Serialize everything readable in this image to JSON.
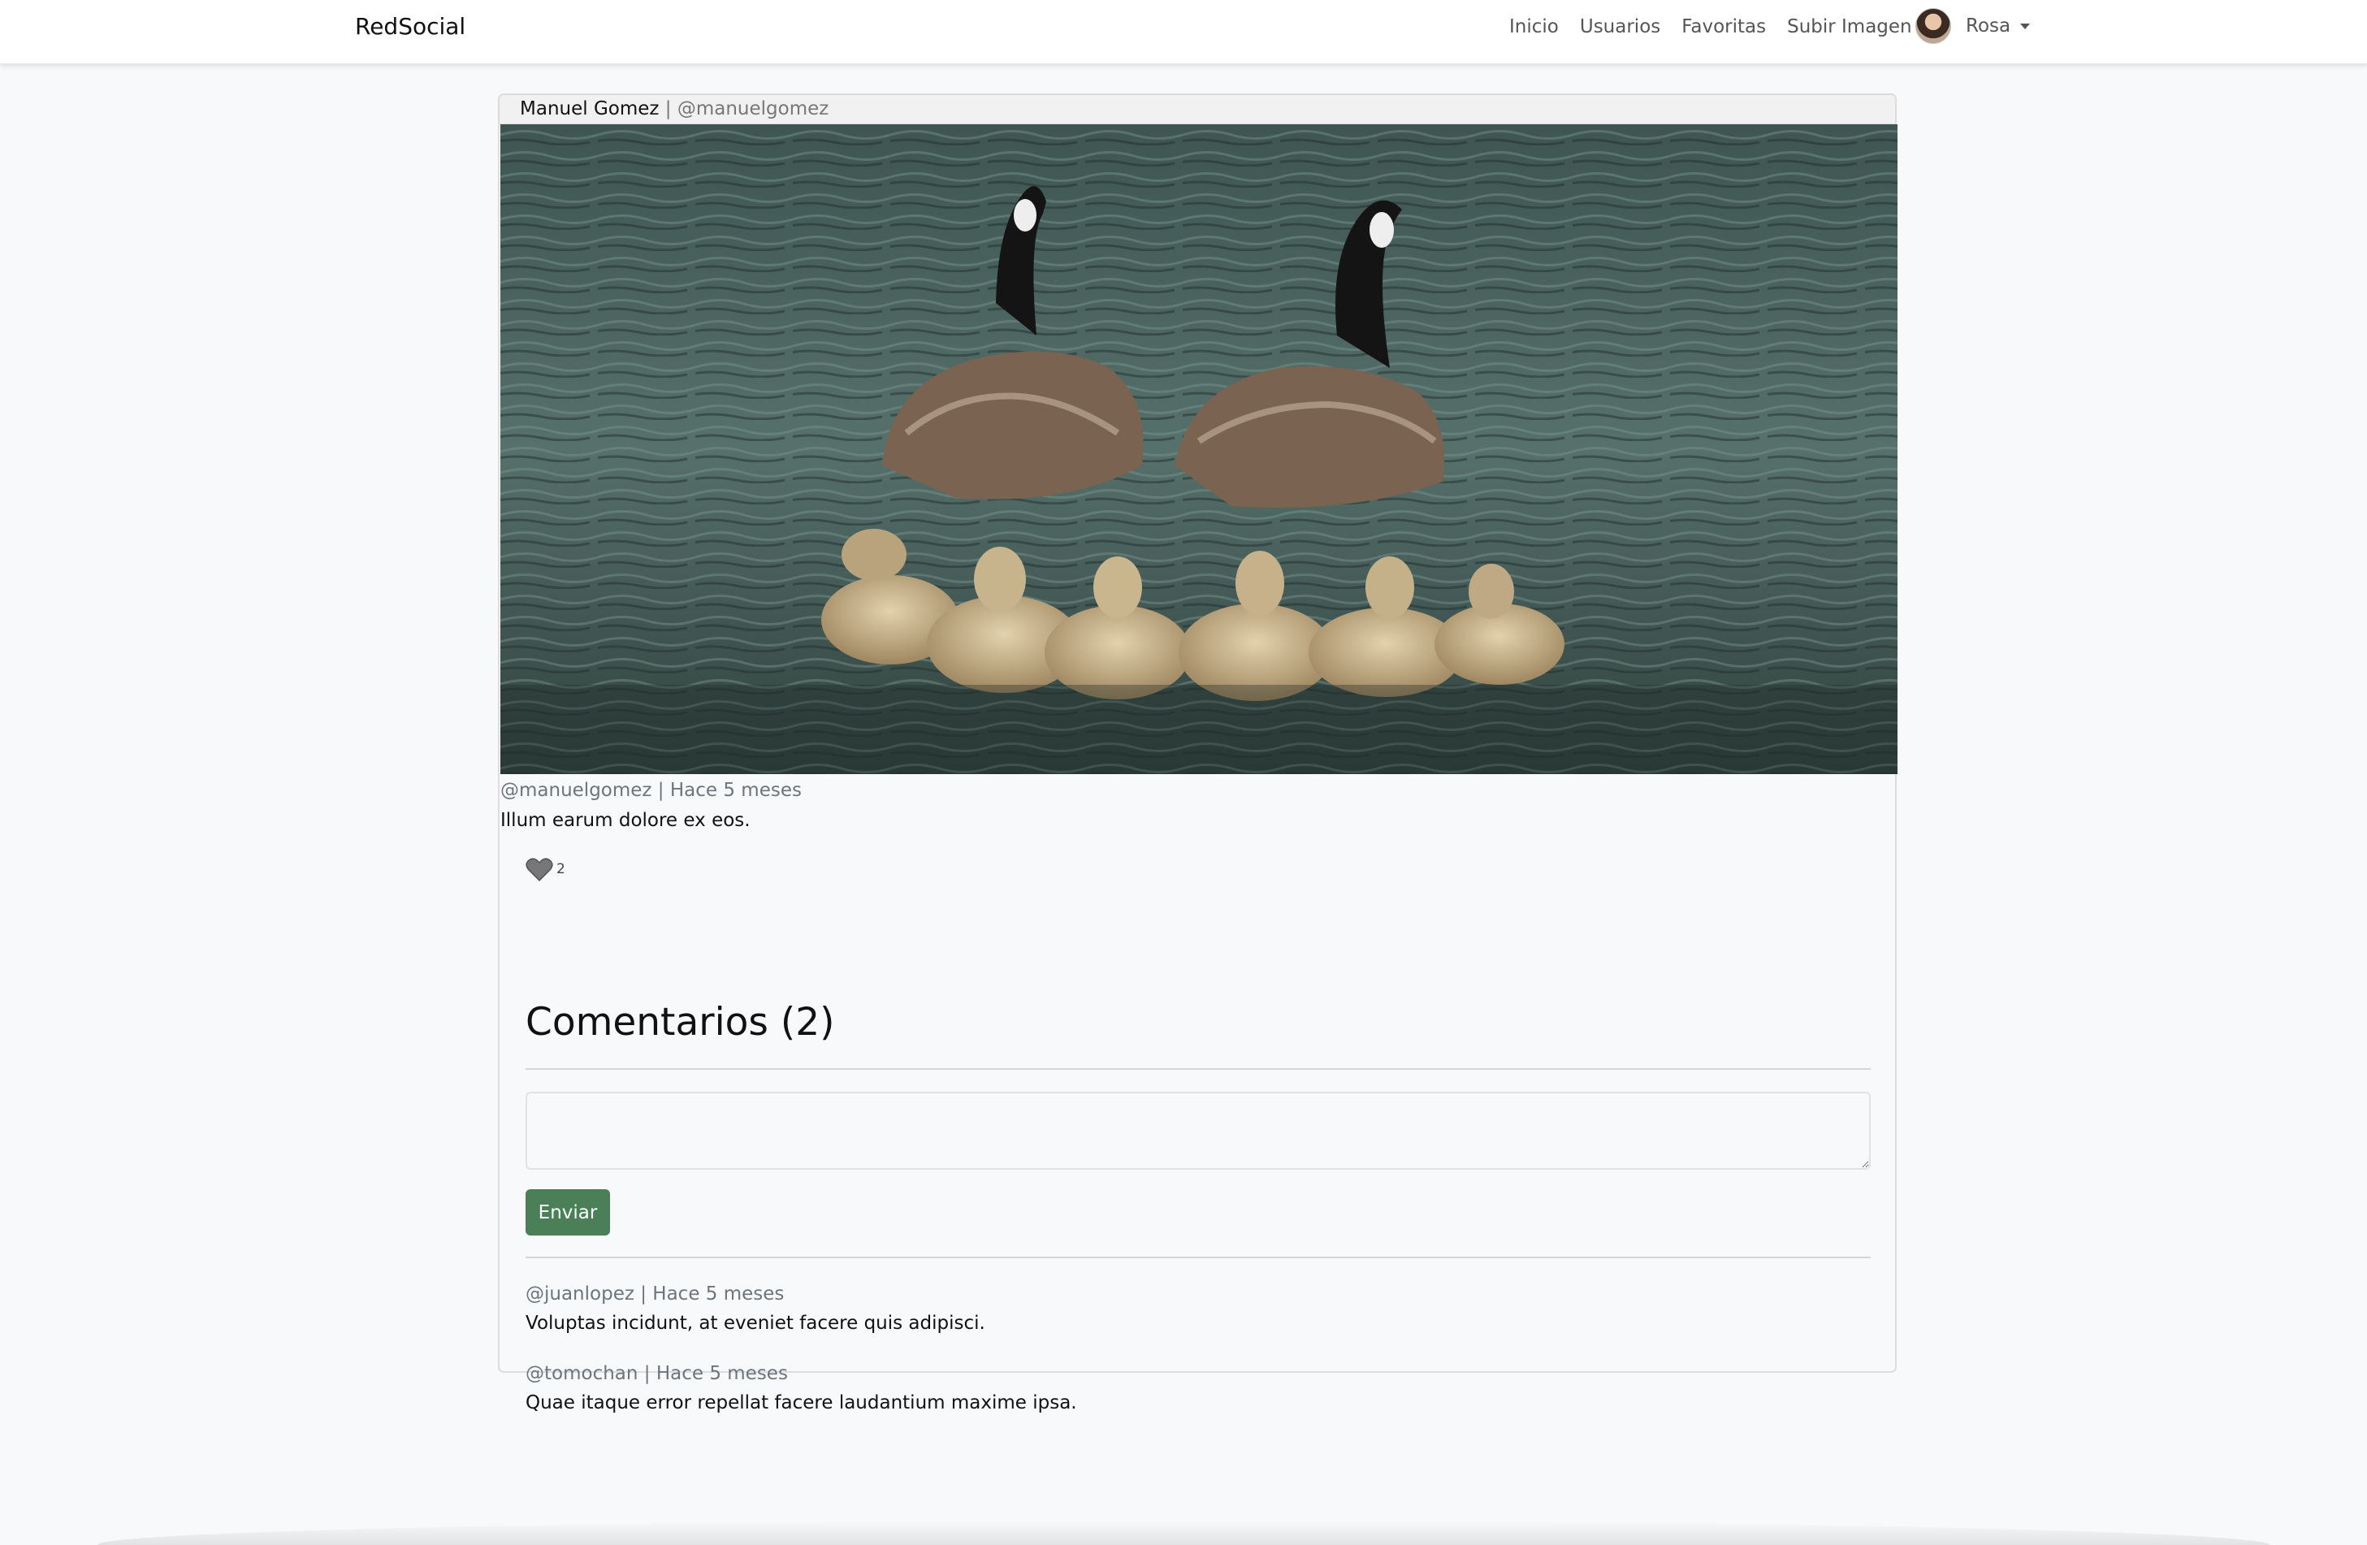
{
  "navbar": {
    "brand": "RedSocial",
    "links": [
      "Inicio",
      "Usuarios",
      "Favoritas",
      "Subir Imagen"
    ],
    "user": {
      "name": "Rosa",
      "avatar_icon": "user-avatar"
    }
  },
  "post": {
    "author_name": "Manuel Gomez",
    "separator": " | ",
    "author_nick": "@manuelgomez",
    "meta": "@manuelgomez | Hace 5 meses",
    "description": "Illum earum dolore ex eos.",
    "likes": "2",
    "like_icon": "heart-icon"
  },
  "comments": {
    "title": "Comentarios (2)",
    "input_value": "",
    "send_label": "Enviar",
    "items": [
      {
        "meta": "@juanlopez | Hace 5 meses",
        "text": "Voluptas incidunt, at eveniet facere quis adipisci."
      },
      {
        "meta": "@tomochan | Hace 5 meses",
        "text": "Quae itaque error repellat facere laudantium maxime ipsa."
      }
    ]
  },
  "colors": {
    "accent": "#4a7f58",
    "muted": "#6c757d",
    "background": "#f8f9fa"
  }
}
